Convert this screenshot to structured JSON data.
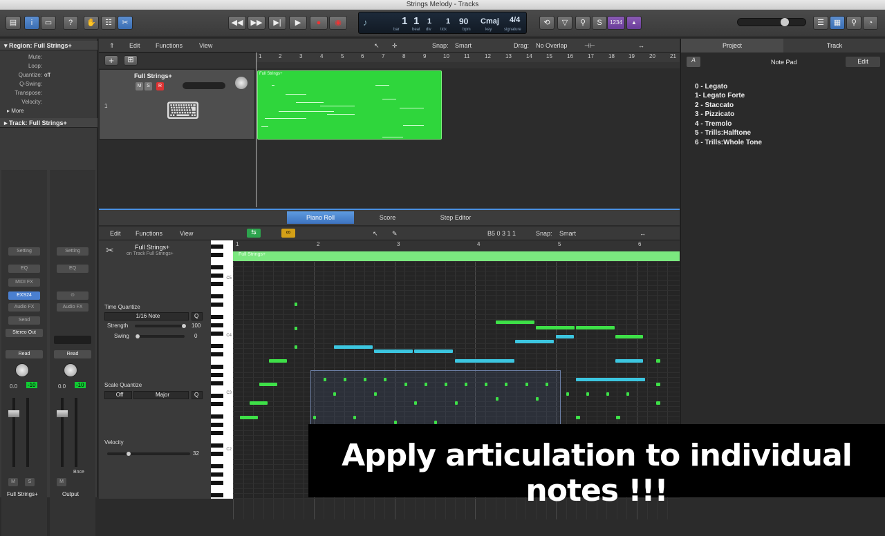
{
  "window": {
    "title": "Strings Melody - Tracks"
  },
  "lcd": {
    "bar": "1",
    "beat": "1",
    "div": "1",
    "tick": "1",
    "bar_l": "bar",
    "beat_l": "beat",
    "div_l": "div",
    "tick_l": "tick",
    "bpm": "90",
    "bpm_l": "bpm",
    "key": "Cmaj",
    "key_l": "key",
    "sig": "4/4",
    "sig_l": "signature"
  },
  "toolbar": {
    "count_in": "1234"
  },
  "inspector": {
    "region_header": "Region: Full Strings+",
    "rows": [
      {
        "k": "Mute:",
        "v": ""
      },
      {
        "k": "Loop:",
        "v": ""
      },
      {
        "k": "Quantize:",
        "v": "off"
      },
      {
        "k": "Q-Swing:",
        "v": ""
      },
      {
        "k": "Transpose:",
        "v": ""
      },
      {
        "k": "Velocity:",
        "v": ""
      }
    ],
    "more": "More",
    "track_header": "Track: Full Strings+",
    "strip1": {
      "setting": "Setting",
      "eq": "EQ",
      "midifx": "MIDI FX",
      "instrument": "EXS24",
      "audiofx": "Audio FX",
      "send": "Send",
      "output": "Stereo Out",
      "read": "Read",
      "vol": "0.0",
      "peak": "-10",
      "m": "M",
      "s": "S",
      "name": "Full Strings+"
    },
    "strip2": {
      "setting": "Setting",
      "eq": "EQ",
      "audiofx": "Audio FX",
      "read": "Read",
      "vol": "0.0",
      "peak": "-10",
      "m": "M",
      "bnce": "Bnce",
      "name": "Output"
    }
  },
  "tracks": {
    "menus": [
      "Edit",
      "Functions",
      "View"
    ],
    "snap_label": "Snap:",
    "snap_value": "Smart",
    "drag_label": "Drag:",
    "drag_value": "No Overlap",
    "ruler": [
      "1",
      "2",
      "3",
      "4",
      "5",
      "6",
      "7",
      "8",
      "9",
      "10",
      "11",
      "12",
      "13",
      "14",
      "15",
      "16",
      "17",
      "18",
      "19",
      "20",
      "21"
    ],
    "track_name": "Full Strings+",
    "track_number": "1",
    "m": "M",
    "s": "S",
    "r": "R",
    "region_name": "Full Strings+"
  },
  "right_panel": {
    "tabs": [
      "Project",
      "Track"
    ],
    "title": "Note Pad",
    "edit": "Edit",
    "lines": [
      "0 - Legato",
      "1- Legato Forte",
      "2 - Staccato",
      "3 - Pizzicato",
      "4 - Tremolo",
      "5 - Trills:Halftone",
      "6 - Trills:Whole Tone"
    ]
  },
  "editor": {
    "tabs": [
      "Piano Roll",
      "Score",
      "Step Editor"
    ],
    "menus": [
      "Edit",
      "Functions",
      "View"
    ],
    "position": "B5  0 3 1 1",
    "snap_label": "Snap:",
    "snap_value": "Smart",
    "region_name": "Full Strings+",
    "region_sub": "on Track Full Strings+",
    "ruler": [
      "1",
      "2",
      "3",
      "4",
      "5",
      "6"
    ],
    "region_bar": "Full Strings+",
    "time_quantize": "Time Quantize",
    "tq_value": "1/16 Note",
    "q": "Q",
    "strength": "Strength",
    "strength_v": "100",
    "swing": "Swing",
    "swing_v": "0",
    "scale_quantize": "Scale Quantize",
    "sq_off": "Off",
    "sq_major": "Major",
    "velocity": "Velocity",
    "velocity_v": "32",
    "key_labels": [
      "C5",
      "C4",
      "C3",
      "C2"
    ]
  },
  "caption": "Apply articulation to individual notes !!!",
  "colors": {
    "green_note": "#3ee048",
    "cyan_note": "#3cc6e0",
    "region": "#2fd63c",
    "accent": "#4a90e2"
  }
}
